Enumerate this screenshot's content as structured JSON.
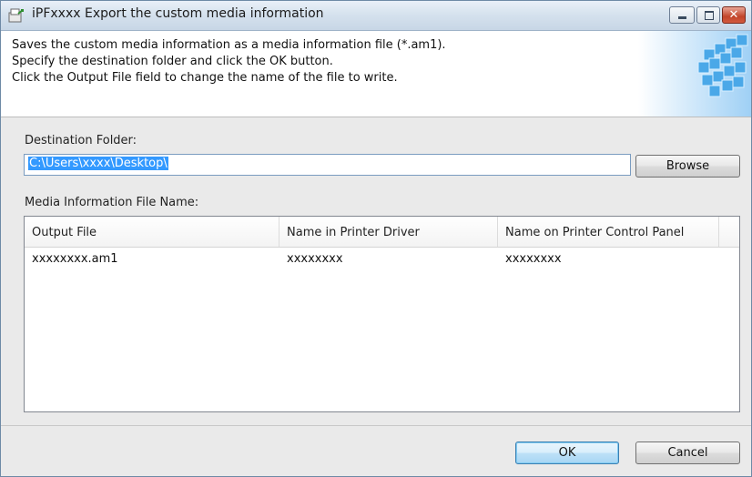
{
  "window": {
    "title": "iPFxxxx Export the custom media information"
  },
  "header": {
    "lines": [
      "Saves the custom media information as a media information file (*.am1).",
      "Specify the destination folder and click the OK button.",
      "Click the Output File field to change the name of the file to write."
    ]
  },
  "destination": {
    "label": "Destination Folder:",
    "value": "C:\\Users\\xxxx\\Desktop\\",
    "browse_label": "Browse"
  },
  "media_file": {
    "label": "Media Information File Name:",
    "columns": [
      "Output File",
      "Name in Printer Driver",
      "Name on Printer Control Panel"
    ],
    "rows": [
      [
        "xxxxxxxx.am1",
        "xxxxxxxx",
        "xxxxxxxx"
      ]
    ]
  },
  "footer": {
    "ok_label": "OK",
    "cancel_label": "Cancel"
  },
  "icons": [
    "app-icon",
    "minimize-icon",
    "maximize-icon",
    "close-icon",
    "header-graphic"
  ],
  "colors": {
    "titlebar": "#d6e2ee",
    "selection": "#3399ff",
    "close_button": "#c2452a",
    "ok_button": "#bde1f7"
  }
}
